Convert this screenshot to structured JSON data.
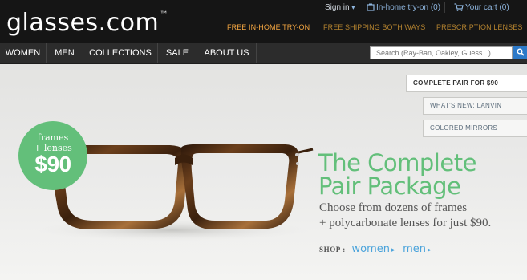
{
  "brand": {
    "logo": "glasses.com",
    "trademark": "™"
  },
  "header": {
    "sign_in": "Sign in",
    "sign_in_caret": "▾",
    "tryon_label": "In-home try-on",
    "tryon_count": "(0)",
    "cart_label": "Your cart",
    "cart_count": "(0)",
    "promos": [
      {
        "label": "FREE IN-HOME TRY-ON",
        "color": "#f2a541"
      },
      {
        "label": "FREE SHIPPING BOTH WAYS",
        "color": "#b3822f"
      },
      {
        "label": "PRESCRIPTION LENSES",
        "color": "#b3822f"
      }
    ]
  },
  "nav": {
    "items": [
      "WOMEN",
      "MEN",
      "COLLECTIONS",
      "SALE",
      "ABOUT US"
    ],
    "search_placeholder": "Search (Ray-Ban, Oakley, Guess...)"
  },
  "hero": {
    "tabs": [
      "COMPLETE PAIR FOR $90",
      "WHAT'S NEW: LANVIN",
      "COLORED MIRRORS"
    ],
    "badge": {
      "line1": "frames",
      "line2": "+ lenses",
      "price": "$90"
    },
    "headline_line1": "The Complete",
    "headline_line2": "Pair Package",
    "subtext_line1": "Choose from dozens of frames",
    "subtext_line2": "+ polycarbonate lenses for just $90.",
    "shop_label": "SHOP :",
    "shop_links": [
      "women",
      "men"
    ],
    "frame_colors": {
      "dark": "#2a160a",
      "mid": "#6b3f1c",
      "light": "#a8703a"
    },
    "accent_green": "#63bf7a",
    "link_blue": "#4aa3db"
  }
}
